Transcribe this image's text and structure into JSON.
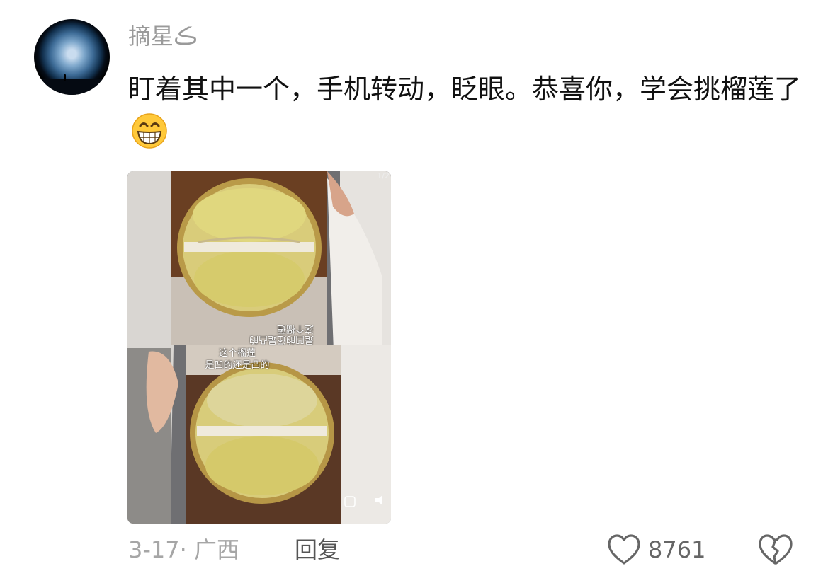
{
  "comment": {
    "username": "摘星ڪ",
    "text": "盯着其中一个，手机转动，眨眼。恭喜你，学会挑榴莲了",
    "emoji": "grinning-face-emoji",
    "media": {
      "counter": "1/2",
      "caption_line1": "这个榴莲",
      "caption_line2": "是凹的还是凸的"
    },
    "date_location": "3-17· 广西",
    "reply_label": "回复",
    "like_count": "8761"
  },
  "colors": {
    "username": "#9a9a9a",
    "text": "#111111",
    "meta": "#a6a6a6",
    "icon": "#666666"
  }
}
